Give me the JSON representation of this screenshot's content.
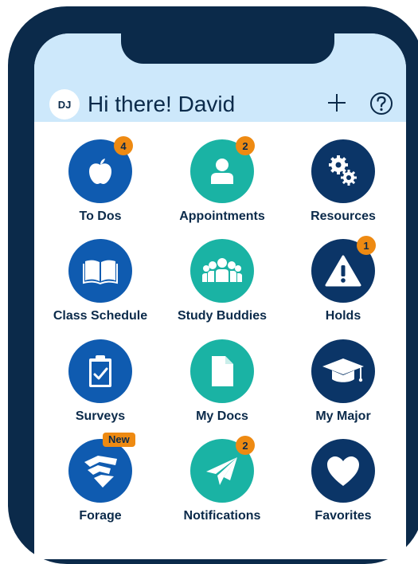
{
  "header": {
    "avatar_initials": "DJ",
    "greeting": "Hi there! David",
    "plus_icon": "plus-icon",
    "help_icon": "help-icon"
  },
  "tiles": [
    {
      "label": "To Dos",
      "icon": "apple-icon",
      "color": "#0f5bb0",
      "badge": "4"
    },
    {
      "label": "Appointments",
      "icon": "person-icon",
      "color": "#1ab3a4",
      "badge": "2"
    },
    {
      "label": "Resources",
      "icon": "gears-icon",
      "color": "#0b3567",
      "badge": ""
    },
    {
      "label": "Class Schedule",
      "icon": "book-icon",
      "color": "#0f5bb0",
      "badge": ""
    },
    {
      "label": "Study Buddies",
      "icon": "group-icon",
      "color": "#1ab3a4",
      "badge": ""
    },
    {
      "label": "Holds",
      "icon": "warning-icon",
      "color": "#0b3567",
      "badge": "1"
    },
    {
      "label": "Surveys",
      "icon": "clipboard-icon",
      "color": "#0f5bb0",
      "badge": ""
    },
    {
      "label": "My Docs",
      "icon": "document-icon",
      "color": "#1ab3a4",
      "badge": ""
    },
    {
      "label": "My Major",
      "icon": "graduation-cap-icon",
      "color": "#0b3567",
      "badge": ""
    },
    {
      "label": "Forage",
      "icon": "forage-logo-icon",
      "color": "#0f5bb0",
      "badge": "New"
    },
    {
      "label": "Notifications",
      "icon": "paper-plane-icon",
      "color": "#1ab3a4",
      "badge": "2"
    },
    {
      "label": "Favorites",
      "icon": "heart-icon",
      "color": "#0b3567",
      "badge": ""
    }
  ],
  "colors": {
    "header_bg": "#cde8fb",
    "frame": "#0b2a4a",
    "badge": "#ee8a12"
  }
}
